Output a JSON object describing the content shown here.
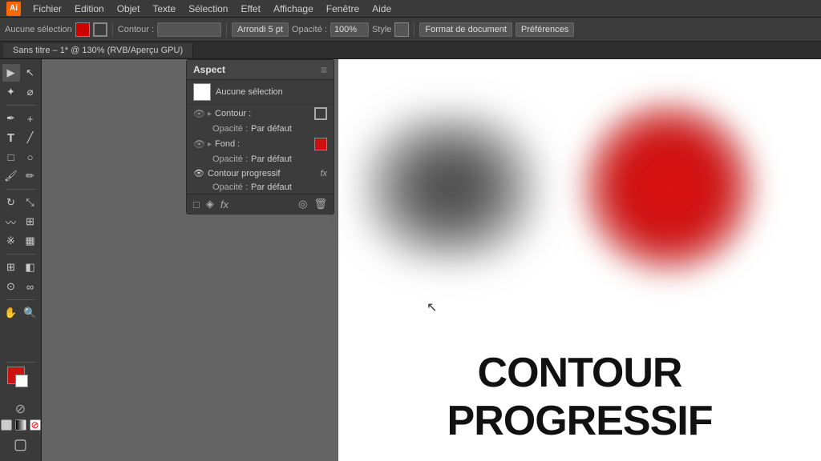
{
  "app": {
    "name": "Illustrator CC"
  },
  "menubar": {
    "logo": "Ai",
    "items": [
      "Fichier",
      "Edition",
      "Objet",
      "Texte",
      "Sélection",
      "Effet",
      "Affichage",
      "Fenêtre",
      "Aide"
    ]
  },
  "toolbar": {
    "selection_label": "Aucune sélection",
    "contour_label": "Contour :",
    "arrondi_label": "Arrondi 5 pt",
    "opacite_label": "Opacité :",
    "opacite_value": "100%",
    "style_label": "Style",
    "format_btn": "Format de document",
    "prefs_btn": "Préférences"
  },
  "tabbar": {
    "doc_tab": "Sans titre – 1* @ 130% (RVB/Aperçu GPU)"
  },
  "aspect_panel": {
    "title": "Aspect",
    "selection_label": "Aucune sélection",
    "rows": [
      {
        "label": "Contour :",
        "type": "stroke"
      },
      {
        "sub_label": "Opacité :",
        "sub_value": "Par défaut"
      },
      {
        "label": "Fond :",
        "type": "fill"
      },
      {
        "sub_label": "Opacité :",
        "sub_value": "Par défaut"
      },
      {
        "label": "Contour progressif",
        "type": "special"
      },
      {
        "sub_label": "Opacité :",
        "sub_value": "Par défaut"
      }
    ]
  },
  "canvas": {
    "main_text": "CONTOUR PROGRESSIF"
  }
}
